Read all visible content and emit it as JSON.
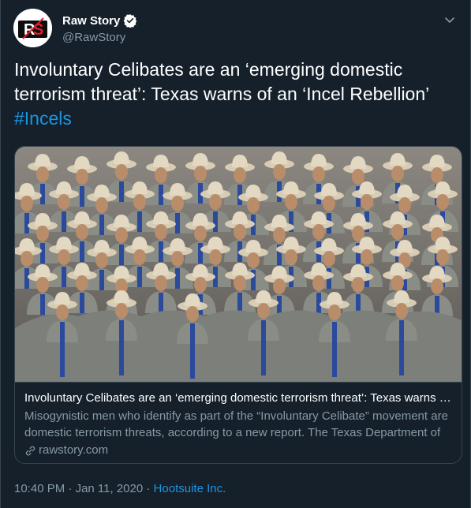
{
  "author": {
    "display_name": "Raw Story",
    "handle": "@RawStory",
    "logo_text": "RS",
    "verified": true
  },
  "tweet": {
    "text": "Involuntary Celibates are an ‘emerging domestic terrorism threat’: Texas warns of an ‘Incel Rebellion’",
    "hashtag": "#Incels"
  },
  "card": {
    "image_desc": "Group photo of uniformed officers in cowboy hats",
    "title": "Involuntary Celibates are an ‘emerging domestic terrorism threat’: Texas warns of...",
    "description": "Misogynistic men who identify as part of the “Involuntary Celibate” movement are domestic terrorism threats, according to a new report. The Texas Department of",
    "domain": "rawstory.com"
  },
  "meta": {
    "time": "10:40 PM",
    "separator": "·",
    "date": "Jan 11, 2020",
    "source": "Hootsuite Inc."
  },
  "colors": {
    "background": "#15202b",
    "border": "#38444d",
    "secondary_text": "#8899a6",
    "link": "#1b95e0",
    "verified": "#ffffff",
    "logo_red": "#e0202a"
  },
  "icons": [
    "verified-badge-icon",
    "chevron-down-icon",
    "link-icon"
  ]
}
